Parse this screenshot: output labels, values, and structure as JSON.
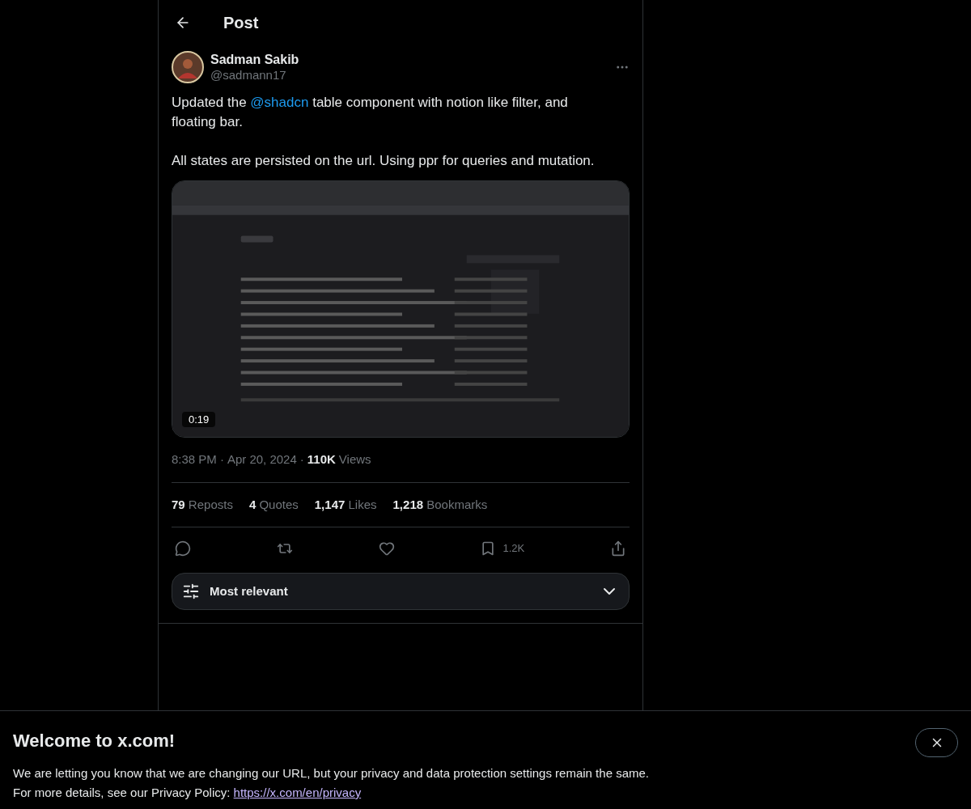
{
  "header": {
    "title": "Post"
  },
  "author": {
    "name": "Sadman Sakib",
    "handle": "@sadmann17"
  },
  "paragraphs": [
    [
      {
        "kind": "text",
        "text": "Updated the "
      },
      {
        "kind": "mention",
        "text": "@shadcn"
      },
      {
        "kind": "text",
        "text": " table component with notion like filter, and floating bar."
      }
    ],
    [
      {
        "kind": "text",
        "text": "All states are persisted on the url. Using ppr for queries and mutation."
      }
    ]
  ],
  "media": {
    "kind": "picture",
    "duration": "0:19"
  },
  "meta": {
    "separator": "·",
    "time": "8:38 PM",
    "date": "Apr 20, 2024",
    "views_count": "110K",
    "views_label": "Views"
  },
  "stats": [
    {
      "count": "79",
      "label": "Reposts"
    },
    {
      "count": "4",
      "label": "Quotes"
    },
    {
      "count": "1,147",
      "label": "Likes"
    },
    {
      "count": "1,218",
      "label": "Bookmarks"
    }
  ],
  "actions": [
    {
      "kind": "reply"
    },
    {
      "kind": "repost"
    },
    {
      "kind": "like"
    },
    {
      "kind": "bookmark",
      "count": "1.2K"
    },
    {
      "kind": "share"
    }
  ],
  "sort": {
    "label": "Most relevant"
  },
  "banner": {
    "title": "Welcome to x.com!",
    "line1": "We are letting you know that we are changing our URL, but your privacy and data protection settings remain the same.",
    "line2_prefix": "For more details, see our Privacy Policy: ",
    "link": "https://x.com/en/privacy"
  }
}
